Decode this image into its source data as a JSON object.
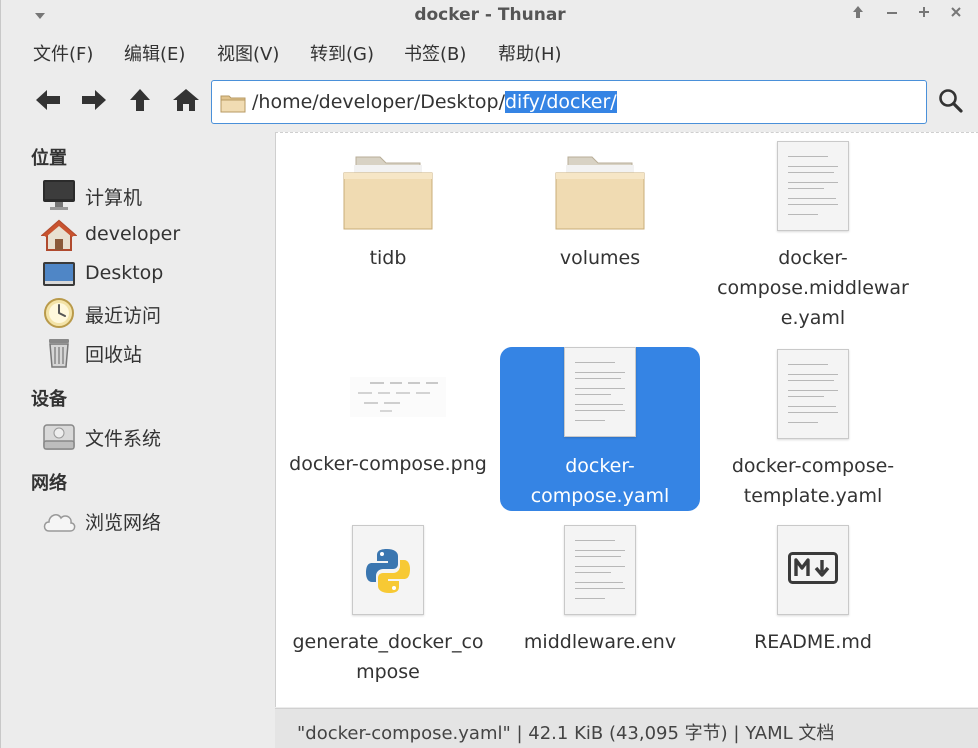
{
  "window": {
    "title": "docker - Thunar"
  },
  "menubar": [
    {
      "label": "文件(F)"
    },
    {
      "label": "编辑(E)"
    },
    {
      "label": "视图(V)"
    },
    {
      "label": "转到(G)"
    },
    {
      "label": "书签(B)"
    },
    {
      "label": "帮助(H)"
    }
  ],
  "address": {
    "path_prefix": "/home/developer/Desktop/",
    "path_selected": "dify/docker/"
  },
  "sidebar": {
    "places_heading": "位置",
    "places": [
      {
        "label": "计算机",
        "icon": "computer-icon"
      },
      {
        "label": "developer",
        "icon": "home-icon"
      },
      {
        "label": "Desktop",
        "icon": "desktop-icon"
      },
      {
        "label": "最近访问",
        "icon": "clock-icon"
      },
      {
        "label": "回收站",
        "icon": "trash-icon"
      }
    ],
    "devices_heading": "设备",
    "devices": [
      {
        "label": "文件系统",
        "icon": "drive-icon"
      }
    ],
    "network_heading": "网络",
    "network": [
      {
        "label": "浏览网络",
        "icon": "cloud-icon"
      }
    ]
  },
  "files": [
    {
      "name_lines": [
        "tidb"
      ],
      "type": "folder"
    },
    {
      "name_lines": [
        "volumes"
      ],
      "type": "folder"
    },
    {
      "name_lines": [
        "docker-",
        "compose.middlewar",
        "e.yaml"
      ],
      "type": "text"
    },
    {
      "name_lines": [
        "docker-compose.png"
      ],
      "type": "image"
    },
    {
      "name_lines": [
        "docker-",
        "compose.yaml"
      ],
      "type": "text",
      "selected": true
    },
    {
      "name_lines": [
        "docker-compose-",
        "template.yaml"
      ],
      "type": "text"
    },
    {
      "name_lines": [
        "generate_docker_co",
        "mpose"
      ],
      "type": "python"
    },
    {
      "name_lines": [
        "middleware.env"
      ],
      "type": "text"
    },
    {
      "name_lines": [
        "README.md"
      ],
      "type": "markdown"
    }
  ],
  "status": {
    "text": "\"docker-compose.yaml\"  |  42.1 KiB (43,095 字节)  |  YAML 文档"
  },
  "colors": {
    "selection": "#3584e4",
    "folder": "#e9d3a6"
  }
}
